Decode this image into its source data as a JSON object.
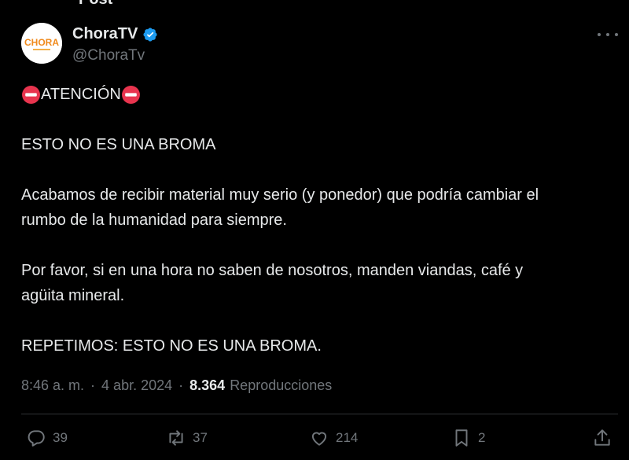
{
  "tweet": {
    "header_partial": "Post",
    "author": {
      "name": "ChoraTV",
      "handle": "@ChoraTv",
      "avatar_text": "CHORA",
      "verified": true
    },
    "lines": {
      "attention": "ATENCIÓN",
      "line1": "ESTO NO ES UNA BROMA",
      "line2a": "Acabamos de recibir material muy serio (y ponedor) que podría cambiar el",
      "line2b": "rumbo de la humanidad para siempre.",
      "line3a": "Por favor, si en una hora no saben de nosotros, manden viandas, café y",
      "line3b": "agüita mineral.",
      "line4": "REPETIMOS: ESTO NO ES UNA BROMA."
    },
    "meta": {
      "time": "8:46 a. m.",
      "separator": "·",
      "date": "4 abr. 2024",
      "views": "8.364",
      "views_label": "Reproducciones"
    },
    "actions": {
      "replies": "39",
      "reposts": "37",
      "likes": "214",
      "bookmarks": "2"
    }
  },
  "colors": {
    "background": "#000000",
    "text": "#e7e9ea",
    "muted": "#71767b",
    "verified": "#1d9bf0",
    "noentry": "#e8344e",
    "divider": "#2f3336"
  },
  "icons": [
    "verified-badge-icon",
    "more-options-icon",
    "no-entry-icon",
    "reply-icon",
    "repost-icon",
    "like-icon",
    "bookmark-icon",
    "share-icon"
  ]
}
